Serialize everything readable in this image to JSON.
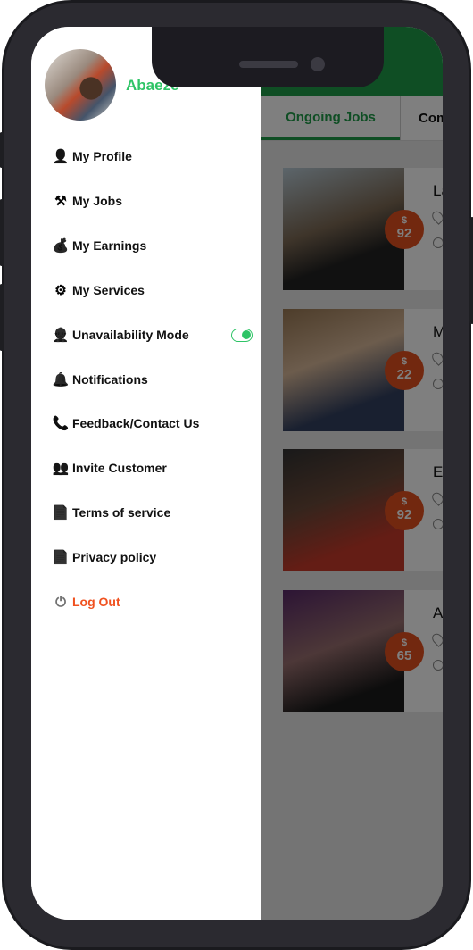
{
  "drawer": {
    "user_name": "Abaeze",
    "items": [
      {
        "label": "My Profile",
        "icon": "person-icon"
      },
      {
        "label": "My Jobs",
        "icon": "worker-icon"
      },
      {
        "label": "My Earnings",
        "icon": "money-hand-icon"
      },
      {
        "label": "My Services",
        "icon": "services-icon"
      },
      {
        "label": "Unavailability Mode",
        "icon": "user-agent-icon"
      },
      {
        "label": "Notifications",
        "icon": "bell-icon"
      },
      {
        "label": "Feedback/Contact Us",
        "icon": "phone-icon"
      },
      {
        "label": "Invite Customer",
        "icon": "group-icon"
      },
      {
        "label": "Terms of service",
        "icon": "document-icon"
      },
      {
        "label": "Privacy policy",
        "icon": "document-icon"
      },
      {
        "label": "Log Out",
        "icon": "power-icon"
      }
    ],
    "unavailability_toggle_on": true
  },
  "main": {
    "tabs": [
      {
        "label": "Ongoing Jobs",
        "active": true
      },
      {
        "label": "Com",
        "active": false
      }
    ],
    "jobs": [
      {
        "name": "La",
        "price_symbol": "$",
        "price": "92"
      },
      {
        "name": "M",
        "price_symbol": "$",
        "price": "22"
      },
      {
        "name": "E",
        "price_symbol": "$",
        "price": "92"
      },
      {
        "name": "A",
        "price_symbol": "$",
        "price": "65"
      }
    ]
  },
  "colors": {
    "accent": "#2ec466",
    "header": "#1f9c48",
    "badge": "#e5501f",
    "logout": "#f0511f"
  }
}
